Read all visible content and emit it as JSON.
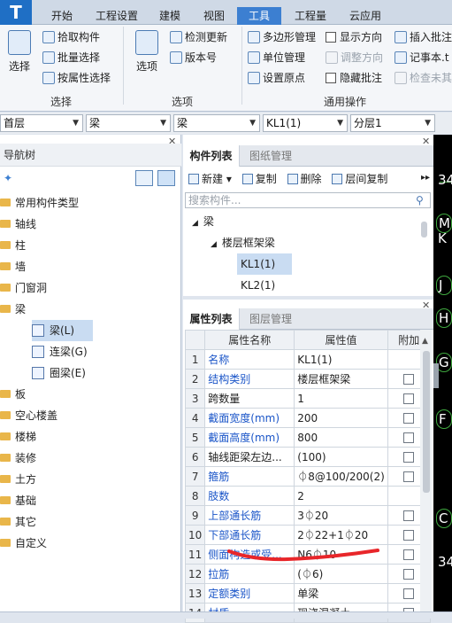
{
  "menu": {
    "logo": "T",
    "tabs": [
      "开始",
      "工程设置",
      "建模",
      "视图",
      "工具",
      "工程量",
      "云应用"
    ],
    "active_tab": "工具"
  },
  "ribbon": {
    "select_group": {
      "button": "选择",
      "items": [
        "拾取构件",
        "批量选择",
        "按属性选择"
      ],
      "label": "选择"
    },
    "options_group": {
      "button": "选项",
      "items": [
        "检测更新",
        "版本号"
      ],
      "label": "选项"
    },
    "common_group": {
      "col1": [
        "多边形管理",
        "单位管理",
        "设置原点"
      ],
      "col2": [
        "显示方向",
        "调整方向",
        "隐藏批注"
      ],
      "col3": [
        "插入批注",
        "记事本.t",
        "检查未其"
      ],
      "label": "通用操作"
    }
  },
  "selectors": [
    "首层",
    "梁",
    "梁",
    "KL1(1)",
    "分层1"
  ],
  "nav": {
    "title": "导航树",
    "items": [
      "常用构件类型",
      "轴线",
      "柱",
      "墙",
      "门窗洞",
      "梁"
    ],
    "beam_children": [
      "梁(L)",
      "连梁(G)",
      "圈梁(E)"
    ],
    "items_after": [
      "板",
      "空心楼盖",
      "楼梯",
      "装修",
      "土方",
      "基础",
      "其它",
      "自定义"
    ]
  },
  "component_list": {
    "tabs": [
      "构件列表",
      "图纸管理"
    ],
    "toolbar": [
      "新建",
      "复制",
      "删除",
      "层间复制"
    ],
    "search_placeholder": "搜索构件...",
    "tree": {
      "root": "梁",
      "child": "楼层框架梁",
      "leaves": [
        "KL1(1)",
        "KL2(1)"
      ]
    }
  },
  "properties": {
    "tabs": [
      "属性列表",
      "图层管理"
    ],
    "headers": [
      "属性名称",
      "属性值",
      "附加"
    ],
    "rows": [
      {
        "n": "1",
        "name": "名称",
        "value": "KL1(1)",
        "blue": true,
        "check": false
      },
      {
        "n": "2",
        "name": "结构类别",
        "value": "楼层框架梁",
        "blue": true,
        "check": true
      },
      {
        "n": "3",
        "name": "跨数量",
        "value": "1",
        "blue": false,
        "check": true
      },
      {
        "n": "4",
        "name": "截面宽度(mm)",
        "value": "200",
        "blue": true,
        "check": true
      },
      {
        "n": "5",
        "name": "截面高度(mm)",
        "value": "800",
        "blue": true,
        "check": true
      },
      {
        "n": "6",
        "name": "轴线距梁左边...",
        "value": "(100)",
        "blue": false,
        "check": true
      },
      {
        "n": "7",
        "name": "箍筋",
        "value": "⏀8@100/200(2)",
        "blue": true,
        "check": true
      },
      {
        "n": "8",
        "name": "肢数",
        "value": "2",
        "blue": true,
        "check": false
      },
      {
        "n": "9",
        "name": "上部通长筋",
        "value": "3⏀20",
        "blue": true,
        "check": true
      },
      {
        "n": "10",
        "name": "下部通长筋",
        "value": "2⏀22+1⏀20",
        "blue": true,
        "check": true
      },
      {
        "n": "11",
        "name": "侧面构造或受...",
        "value": "N6⏀10",
        "blue": true,
        "check": true
      },
      {
        "n": "12",
        "name": "拉筋",
        "value": "(⏀6)",
        "blue": true,
        "check": true
      },
      {
        "n": "13",
        "name": "定额类别",
        "value": "单梁",
        "blue": true,
        "check": true
      },
      {
        "n": "14",
        "name": "材质",
        "value": "现浇混凝土",
        "blue": true,
        "check": true
      }
    ]
  },
  "canvas_axes": [
    "34",
    "M",
    "K",
    "J",
    "H",
    "G",
    "F",
    "C",
    "34"
  ],
  "colors": {
    "accent": "#3c7fd1",
    "property_name": "#1a55c8",
    "annotation_stroke": "#e8262a",
    "canvas_bg": "#000000",
    "axis_green": "#3fa83f"
  }
}
